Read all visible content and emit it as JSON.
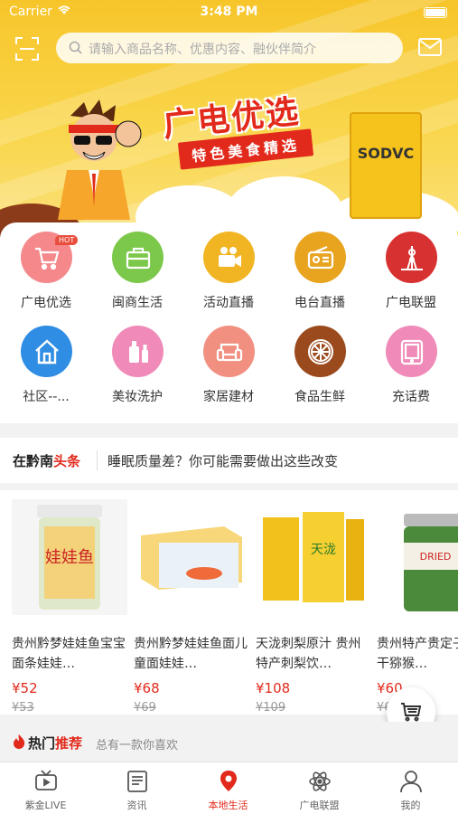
{
  "status_bar": {
    "carrier": "Carrier",
    "time": "3:48 PM"
  },
  "search": {
    "placeholder": "请输入商品名称、优惠内容、融伙伴简介"
  },
  "banner": {
    "title": "广电优选",
    "subtitle": "特色美食精选",
    "product_label": "SODVC"
  },
  "categories": [
    {
      "label": "广电优选",
      "icon": "shopping-cart-icon",
      "color": "#f4888b",
      "badge": "HOT"
    },
    {
      "label": "闽商生活",
      "icon": "briefcase-icon",
      "color": "#7cc84a"
    },
    {
      "label": "活动直播",
      "icon": "video-camera-icon",
      "color": "#f1b523"
    },
    {
      "label": "电台直播",
      "icon": "radio-icon",
      "color": "#e8a31f"
    },
    {
      "label": "广电联盟",
      "icon": "tower-icon",
      "color": "#d83131"
    },
    {
      "label": "社区--...",
      "icon": "house-icon",
      "color": "#2f8de4"
    },
    {
      "label": "美妆洗护",
      "icon": "cosmetics-icon",
      "color": "#f08ab8"
    },
    {
      "label": "家居建材",
      "icon": "sofa-icon",
      "color": "#f19080"
    },
    {
      "label": "食品生鲜",
      "icon": "lemon-slice-icon",
      "color": "#9b4a1e"
    },
    {
      "label": "充话费",
      "icon": "tablet-icon",
      "color": "#f08ab8"
    }
  ],
  "ticker": {
    "brand_prefix": "在黔南",
    "brand_suffix": "头条",
    "headline": "睡眠质量差？你可能需要做出这些改变"
  },
  "products": [
    {
      "name": "贵州黔梦娃娃鱼宝宝面条娃娃…",
      "price": "¥52",
      "old_price": "¥53"
    },
    {
      "name": "贵州黔梦娃娃鱼面儿童面娃娃…",
      "price": "¥68",
      "old_price": "¥69"
    },
    {
      "name": "天泷刺梨原汁 贵州特产刺梨饮…",
      "price": "¥108",
      "old_price": "¥109"
    },
    {
      "name": "贵州特产贵定子猕猴干猕猴…",
      "price": "¥60",
      "old_price": "¥6"
    }
  ],
  "hot_recommend": {
    "title_prefix": "热门",
    "title_suffix": "推荐",
    "subtitle": "总有一款你喜欢"
  },
  "tabs": [
    {
      "label": "紫金LIVE",
      "icon": "tv-icon"
    },
    {
      "label": "资讯",
      "icon": "news-icon"
    },
    {
      "label": "本地生活",
      "icon": "location-pin-icon",
      "active": true
    },
    {
      "label": "广电联盟",
      "icon": "atom-icon"
    },
    {
      "label": "我的",
      "icon": "person-icon"
    }
  ],
  "colors": {
    "accent": "#e22a1c",
    "banner": "#f7c52a"
  }
}
